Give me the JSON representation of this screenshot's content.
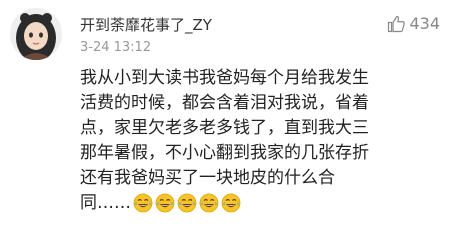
{
  "comment": {
    "username": "开到荼靡花事了_ZY",
    "time": "3-24 13:12",
    "likes": "434",
    "content_lines": [
      "我从小到大读书我爸妈每个月给我发生",
      "活费的时候，都会含着泪对我说，省着",
      "点，家里欠老多老多钱了，直到我大三",
      "那年暑假，不小心翻到我家的几张存折",
      "还有我爸妈买了一块地皮的什么合",
      "同……"
    ],
    "emoji_count": 5,
    "emoji_name": "laughing-crying-emoji",
    "like_icon": "thumbs-up-icon",
    "colors": {
      "username": "#333333",
      "time": "#999999",
      "text": "#222222",
      "emoji_face": "#f7c52b"
    }
  }
}
